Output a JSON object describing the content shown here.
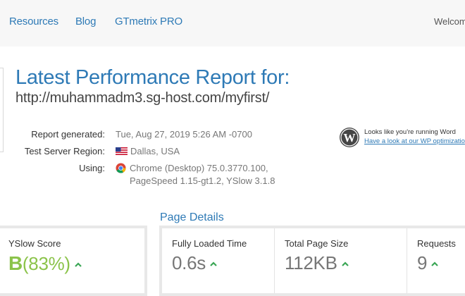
{
  "nav": {
    "items": [
      "Resources",
      "Blog",
      "GTmetrix PRO"
    ],
    "welcome": "Welcom"
  },
  "report": {
    "title": "Latest Performance Report for:",
    "url": "http://muhammadm3.sg-host.com/myfirst/",
    "generated_label": "Report generated:",
    "generated_value": "Tue, Aug 27, 2019 5:26 AM -0700",
    "region_label": "Test Server Region:",
    "region_value": "Dallas, USA",
    "region_icon": "us-flag-icon",
    "using_label": "Using:",
    "using_line1": "Chrome (Desktop) 75.0.3770.100,",
    "using_line2": "PageSpeed 1.15-gt1.2, YSlow 3.1.8",
    "using_icon": "chrome-icon"
  },
  "wp_notice": {
    "line1": "Looks like you're running Word",
    "link": "Have a look at our WP optimizatio",
    "icon": "wordpress-icon"
  },
  "page_details": {
    "heading": "Page Details"
  },
  "yslow": {
    "label": "YSlow Score",
    "grade": "B",
    "percent": "(83%)"
  },
  "metrics": {
    "fully_loaded_label": "Fully Loaded Time",
    "fully_loaded_value": "0.6s",
    "page_size_label": "Total Page Size",
    "page_size_value": "112KB",
    "requests_label": "Requests",
    "requests_value": "9"
  },
  "colors": {
    "link_blue": "#2e7ab6",
    "grade_green": "#8bc34a",
    "trend_arrow": "#3aa655"
  }
}
